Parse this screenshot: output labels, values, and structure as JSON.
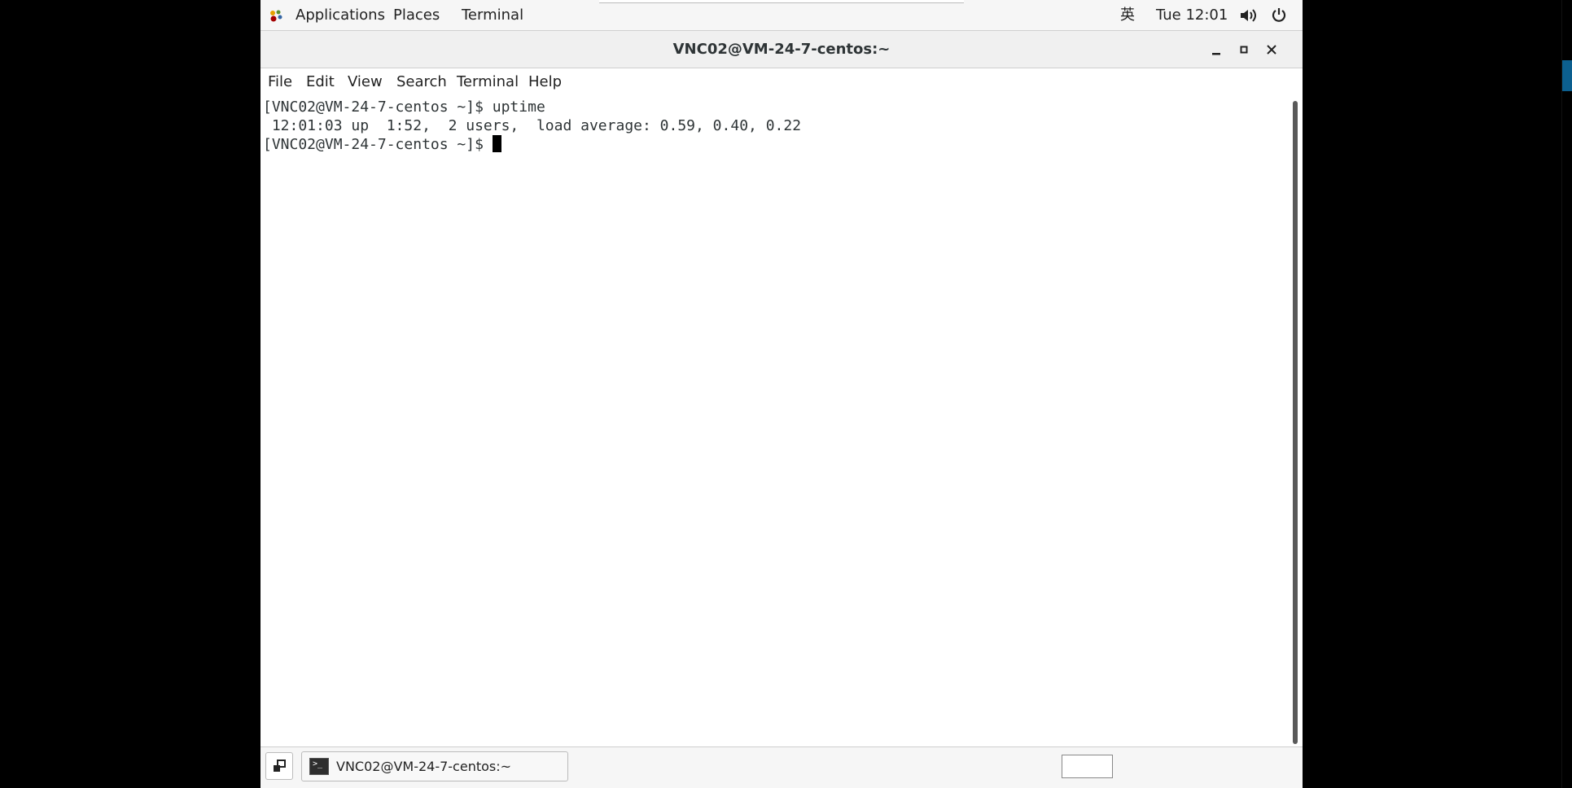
{
  "top_panel": {
    "applications_label": "Applications",
    "places_label": "Places",
    "terminal_label": "Terminal",
    "input_method": "英",
    "clock": "Tue 12:01",
    "volume_icon": "volume-icon",
    "power_icon": "power-icon"
  },
  "window": {
    "title": "VNC02@VM-24-7-centos:~",
    "minimize": "_",
    "maximize": "▫",
    "close": "✕"
  },
  "menubar": {
    "items": [
      "File",
      "Edit",
      "View",
      "Search",
      "Terminal",
      "Help"
    ]
  },
  "terminal": {
    "lines": [
      "[VNC02@VM-24-7-centos ~]$ uptime",
      " 12:01:03 up  1:52,  2 users,  load average: 0.59, 0.40, 0.22",
      "[VNC02@VM-24-7-centos ~]$ "
    ]
  },
  "taskbar": {
    "task_label": "VNC02@VM-24-7-centos:~"
  },
  "colors": {
    "panel_bg": "#f6f6f6",
    "terminal_bg": "#ffffff",
    "terminal_fg": "#2e3436",
    "desktop_bg": "#000000",
    "accent": "#0c5f8f"
  }
}
